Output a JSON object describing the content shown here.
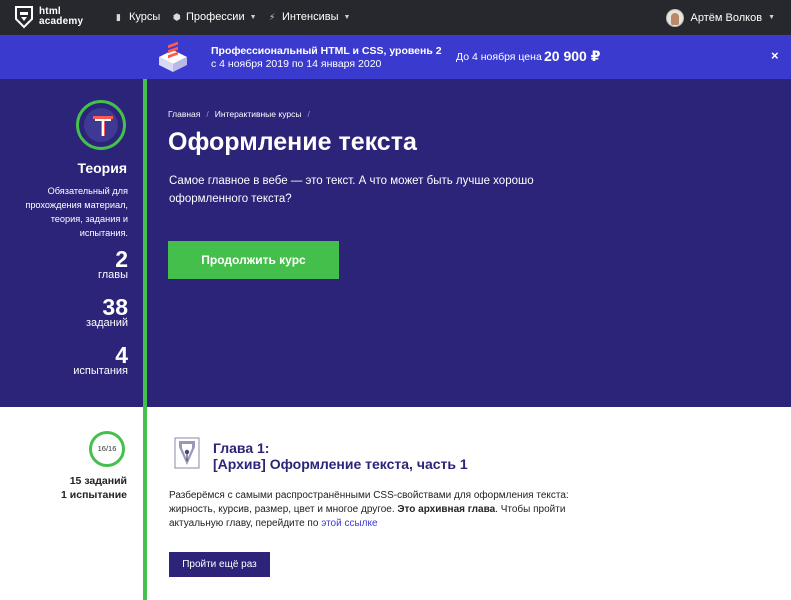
{
  "nav": {
    "logo_line1": "html",
    "logo_line2": "academy",
    "items": [
      {
        "label": "Курсы",
        "icon": "book-icon"
      },
      {
        "label": "Профессии",
        "icon": "cube-icon"
      },
      {
        "label": "Интенсивы",
        "icon": "lightning-icon"
      }
    ],
    "user_name": "Артём Волков"
  },
  "promo": {
    "title": "Профессиональный HTML и CSS, уровень 2",
    "dates": "с 4 ноября 2019 по 14 января 2020",
    "price_label": "До 4 ноября цена",
    "price": "20 900 ₽",
    "close": "×"
  },
  "sidebar": {
    "title": "Теория",
    "description": "Обязательный для прохождения материал, теория, задания и испытания.",
    "stats": [
      {
        "value": "2",
        "label": "главы"
      },
      {
        "value": "38",
        "label": "заданий"
      },
      {
        "value": "4",
        "label": "испытания"
      }
    ]
  },
  "breadcrumb": [
    "Главная",
    "Интерактивные курсы"
  ],
  "hero": {
    "title": "Оформление текста",
    "description": "Самое главное в вебе — это текст. А что может быть лучше хорошо оформленного текста?",
    "button": "Продолжить курс"
  },
  "chapter": {
    "progress": "16/16",
    "tasks": "15 заданий",
    "tests": "1 испытание",
    "label": "Глава 1:",
    "title": "[Архив] Оформление текста, часть 1",
    "desc_part1": "Разберёмся с самыми распространёнными CSS-свойствами для оформления текста: жирность, курсив, размер, цвет и многое другое. ",
    "desc_bold": "Это архивная глава",
    "desc_part2": ". Чтобы пройти актуальную главу, перейдите по ",
    "desc_link": "этой ссылке",
    "button": "Пройти ещё раз"
  },
  "colors": {
    "nav_bg": "#27282d",
    "promo_bg": "#3a3acf",
    "hero_bg": "#2b2479",
    "accent_green": "#44c04c",
    "link": "#3a3acf"
  }
}
